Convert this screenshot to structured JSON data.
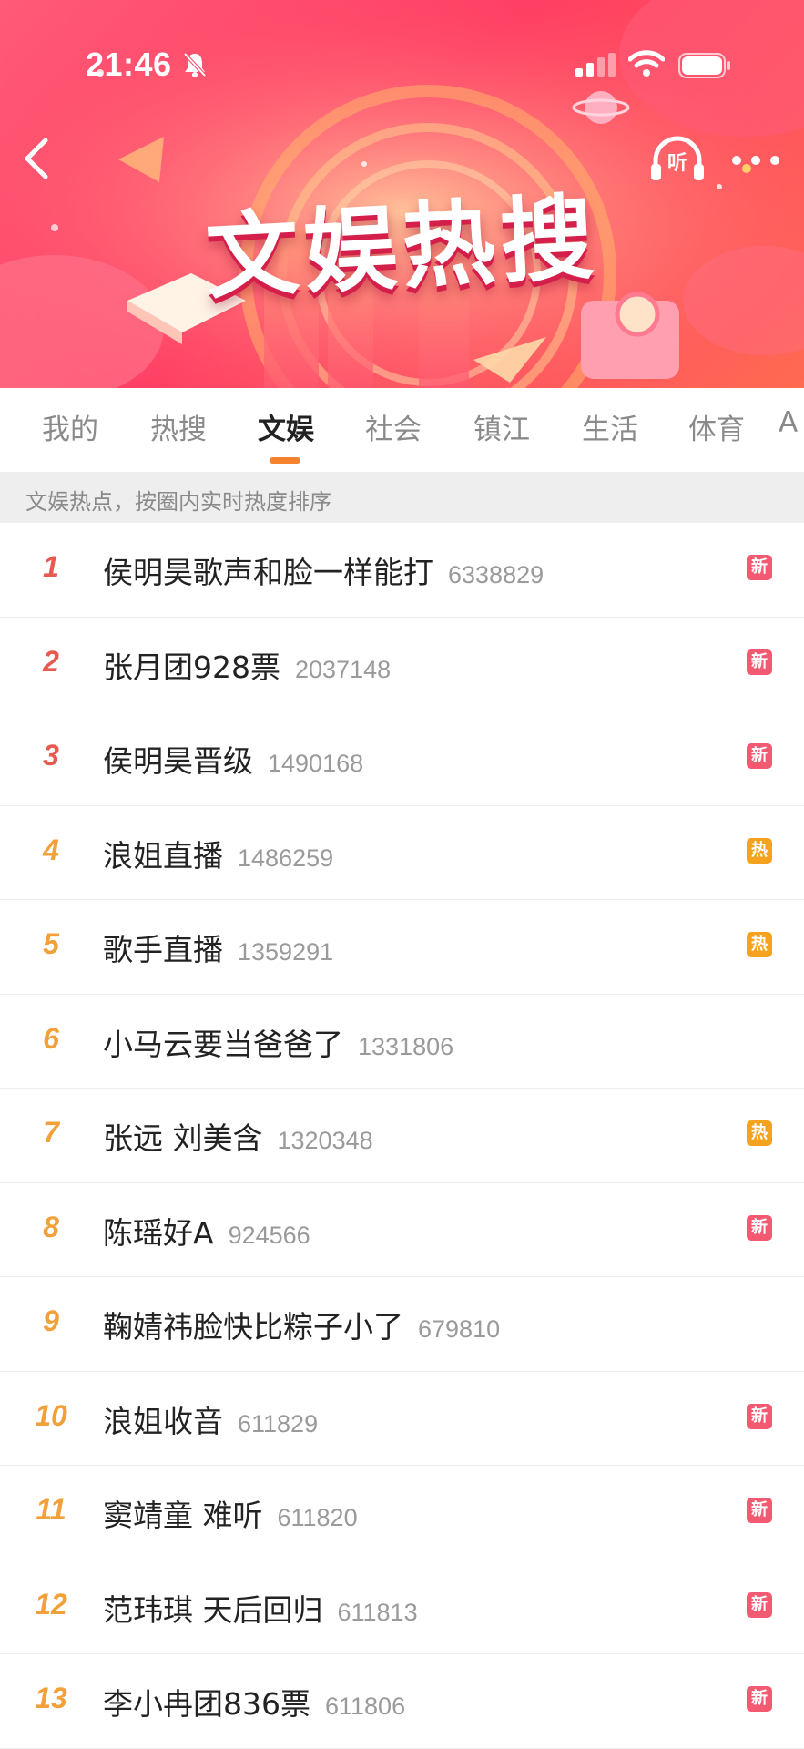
{
  "status_bar": {
    "time": "21:46"
  },
  "header": {
    "title": "文娱热搜",
    "listen_label": "听"
  },
  "tabs": [
    {
      "label": "我的",
      "active": false
    },
    {
      "label": "热搜",
      "active": false
    },
    {
      "label": "文娱",
      "active": true
    },
    {
      "label": "社会",
      "active": false
    },
    {
      "label": "镇江",
      "active": false
    },
    {
      "label": "生活",
      "active": false
    },
    {
      "label": "体育",
      "active": false
    },
    {
      "label": "A",
      "active": false
    }
  ],
  "subtitle": "文娱热点，按圈内实时热度排序",
  "colors": {
    "badge_new": "#f25a72",
    "badge_hot": "#f5a21f",
    "rank_top3": "#e8594f",
    "rank_other": "#f2a03a",
    "tab_indicator": "#f7822e"
  },
  "items": [
    {
      "rank": "1",
      "title": "侯明昊歌声和脸一样能打",
      "count": "6338829",
      "badge": "新",
      "badge_type": "new"
    },
    {
      "rank": "2",
      "title": "张月团928票",
      "count": "2037148",
      "badge": "新",
      "badge_type": "new"
    },
    {
      "rank": "3",
      "title": "侯明昊晋级",
      "count": "1490168",
      "badge": "新",
      "badge_type": "new"
    },
    {
      "rank": "4",
      "title": "浪姐直播",
      "count": "1486259",
      "badge": "热",
      "badge_type": "hot"
    },
    {
      "rank": "5",
      "title": "歌手直播",
      "count": "1359291",
      "badge": "热",
      "badge_type": "hot"
    },
    {
      "rank": "6",
      "title": "小马云要当爸爸了",
      "count": "1331806",
      "badge": "",
      "badge_type": ""
    },
    {
      "rank": "7",
      "title": "张远 刘美含",
      "count": "1320348",
      "badge": "热",
      "badge_type": "hot"
    },
    {
      "rank": "8",
      "title": "陈瑶好A",
      "count": "924566",
      "badge": "新",
      "badge_type": "new"
    },
    {
      "rank": "9",
      "title": "鞠婧祎脸快比粽子小了",
      "count": "679810",
      "badge": "",
      "badge_type": ""
    },
    {
      "rank": "10",
      "title": "浪姐收音",
      "count": "611829",
      "badge": "新",
      "badge_type": "new"
    },
    {
      "rank": "11",
      "title": "窦靖童 难听",
      "count": "611820",
      "badge": "新",
      "badge_type": "new"
    },
    {
      "rank": "12",
      "title": "范玮琪 天后回归",
      "count": "611813",
      "badge": "新",
      "badge_type": "new"
    },
    {
      "rank": "13",
      "title": "李小冉团836票",
      "count": "611806",
      "badge": "新",
      "badge_type": "new"
    }
  ]
}
